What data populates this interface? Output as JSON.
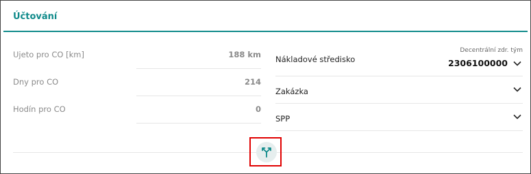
{
  "section": {
    "title": "Účtování"
  },
  "left_fields": [
    {
      "label": "Ujeto pro CO [km]",
      "value": "188 km"
    },
    {
      "label": "Dny pro CO",
      "value": "214"
    },
    {
      "label": "Hodín pro CO",
      "value": "0"
    }
  ],
  "right_fields": {
    "cost_center": {
      "label": "Nákladové středisko",
      "caption": "Decentrální zdr. tým",
      "value": "2306100000",
      "icon": "chevron-down-icon"
    },
    "order": {
      "label": "Zakázka",
      "icon": "chevron-down-icon"
    },
    "spp": {
      "label": "SPP",
      "icon": "chevron-down-icon"
    }
  },
  "fork_button": {
    "icon": "fork-split-icon",
    "color": "#0f8a8a"
  },
  "colors": {
    "accent": "#0f8a8a",
    "highlight": "#e00000"
  }
}
